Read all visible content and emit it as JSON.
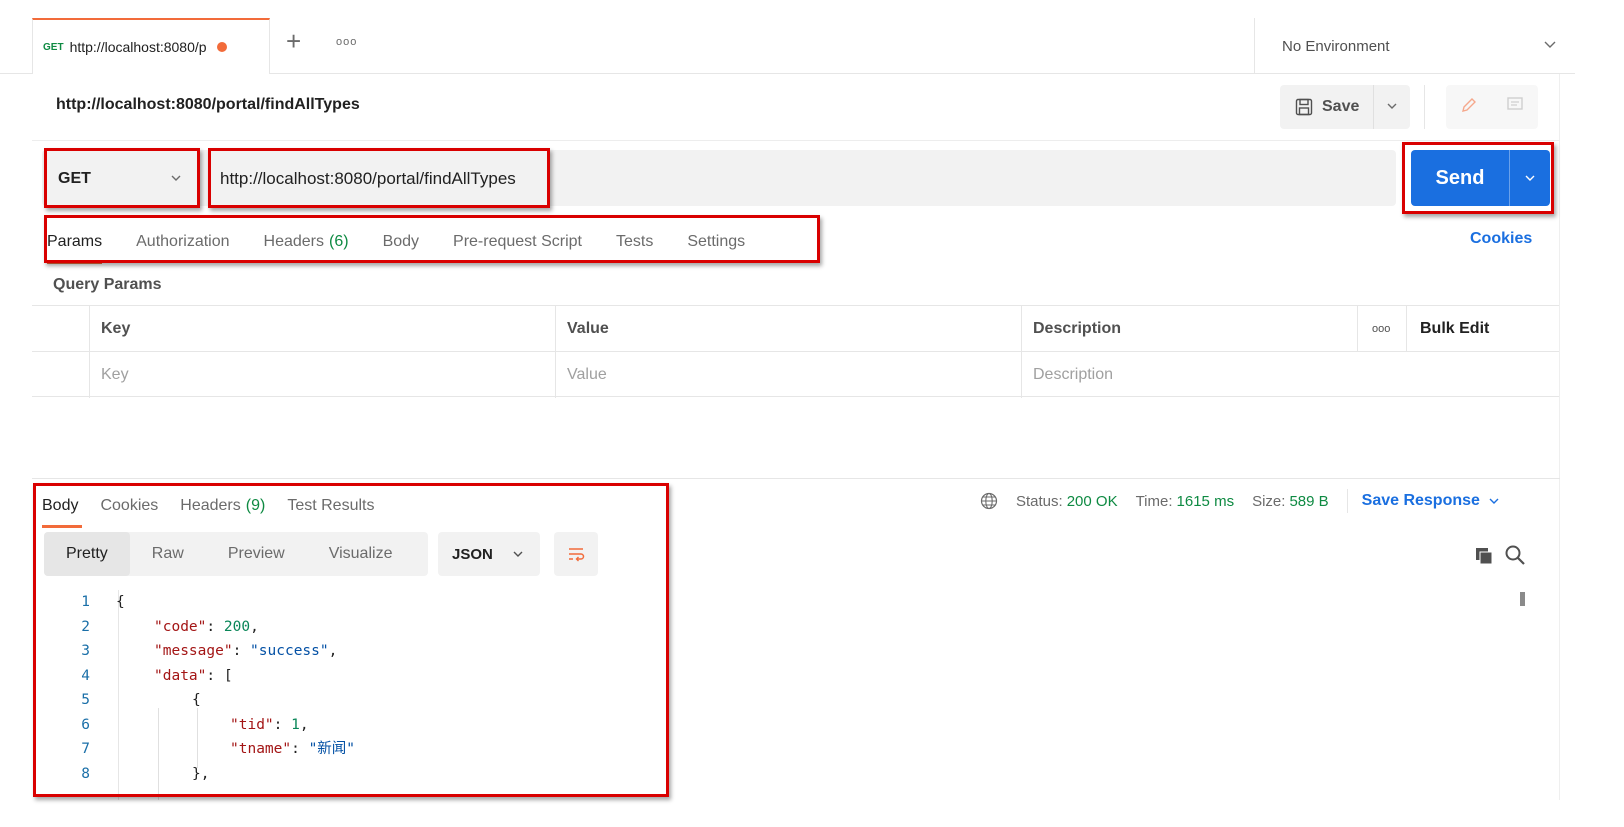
{
  "tab": {
    "method": "GET",
    "url": "http://localhost:8080/p",
    "new_tab": "+",
    "more": "ooo"
  },
  "environment": {
    "selected": "No Environment"
  },
  "request": {
    "title": "http://localhost:8080/portal/findAllTypes",
    "save_label": "Save",
    "method": "GET",
    "url": "http://localhost:8080/portal/findAllTypes",
    "send_label": "Send"
  },
  "request_tabs": [
    {
      "label": "Params"
    },
    {
      "label": "Authorization"
    },
    {
      "label": "Headers",
      "count": "(6)"
    },
    {
      "label": "Body"
    },
    {
      "label": "Pre-request Script"
    },
    {
      "label": "Tests"
    },
    {
      "label": "Settings"
    }
  ],
  "cookies_link": "Cookies",
  "query_params": {
    "title": "Query Params",
    "headers": {
      "key": "Key",
      "value": "Value",
      "description": "Description",
      "more": "ooo",
      "bulk_edit": "Bulk Edit"
    },
    "placeholders": {
      "key": "Key",
      "value": "Value",
      "description": "Description"
    }
  },
  "response": {
    "tabs": [
      {
        "label": "Body"
      },
      {
        "label": "Cookies"
      },
      {
        "label": "Headers",
        "count": "(9)"
      },
      {
        "label": "Test Results"
      }
    ],
    "status_label": "Status:",
    "status_value": "200 OK",
    "time_label": "Time:",
    "time_value": "1615 ms",
    "size_label": "Size:",
    "size_value": "589 B",
    "save_response": "Save Response",
    "views": [
      "Pretty",
      "Raw",
      "Preview",
      "Visualize"
    ],
    "format": "JSON",
    "code_lines": [
      "1",
      "2",
      "3",
      "4",
      "5",
      "6",
      "7",
      "8"
    ]
  },
  "json": {
    "code_key": "\"code\"",
    "code_val": "200",
    "message_key": "\"message\"",
    "message_val": "\"success\"",
    "data_key": "\"data\"",
    "tid_key": "\"tid\"",
    "tid_val": "1",
    "tname_key": "\"tname\"",
    "tname_val": "\"新闻\""
  },
  "colors": {
    "accent_orange": "#f26b3a",
    "send_blue": "#1a6fe0",
    "status_green": "#0e8a42",
    "annotation_red": "#d90000"
  }
}
